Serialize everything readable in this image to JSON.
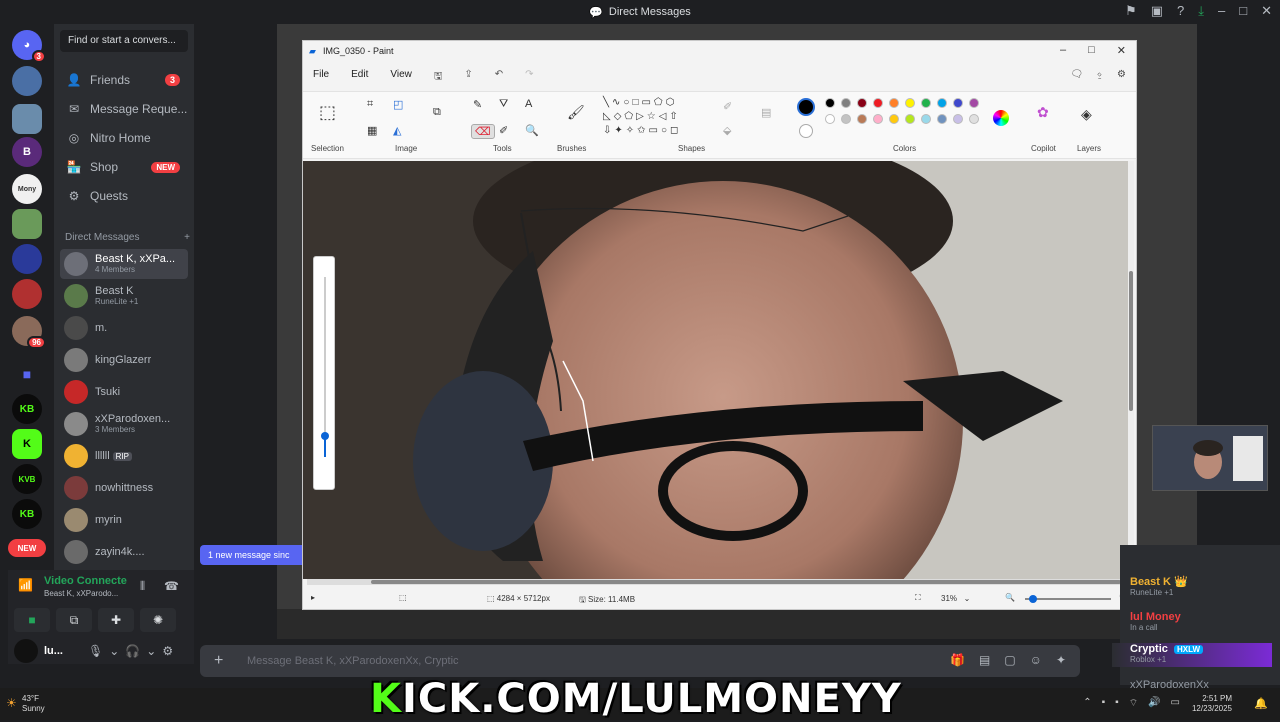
{
  "titlebar": {
    "title": "Direct Messages"
  },
  "sidebar": {
    "search_placeholder": "Find or start a convers...",
    "nav": [
      {
        "label": "Friends",
        "badge": "3"
      },
      {
        "label": "Message Reque..."
      },
      {
        "label": "Nitro Home"
      },
      {
        "label": "Shop",
        "badge": "NEW"
      },
      {
        "label": "Quests"
      }
    ],
    "dm_header": "Direct Messages",
    "dm_add": "+",
    "dms": [
      {
        "name": "Beast K, xXPa...",
        "sub": "4 Members",
        "color": "#6d6f78"
      },
      {
        "name": "Beast K",
        "sub": "RuneLite +1",
        "color": "#5a7a4a"
      },
      {
        "name": "m.",
        "sub": "",
        "color": "#4a4a4a"
      },
      {
        "name": "kingGlazerr",
        "sub": "",
        "color": "#7a7a7a"
      },
      {
        "name": "Tsuki",
        "sub": "",
        "color": "#c62828"
      },
      {
        "name": "xXParodoxen...",
        "sub": "3 Members",
        "color": "#8a8a8a"
      },
      {
        "name": "llllll",
        "tag": "RIP",
        "sub": "",
        "color": "#f0b232"
      },
      {
        "name": "nowhittness",
        "sub": "",
        "color": "#7b3b3b"
      },
      {
        "name": "myrin",
        "sub": "",
        "color": "#9a8a70"
      },
      {
        "name": "zayin4k....",
        "sub": "",
        "color": "#6a6a6a"
      }
    ],
    "new_messages_banner": "1 new message sinc"
  },
  "rail": {
    "badges": {
      "top": "3",
      "mid": "96"
    },
    "new_label": "NEW"
  },
  "voice": {
    "status": "Video Connecte",
    "channel": "Beast K, xXParodo..."
  },
  "user": {
    "name": "lu..."
  },
  "composer": {
    "plus": "+",
    "placeholder": "Message Beast K, xXParodoxenXx, Cryptic"
  },
  "paint": {
    "title": "IMG_0350 - Paint",
    "menu": [
      "File",
      "Edit",
      "View"
    ],
    "groups": [
      "Selection",
      "Image",
      "Tools",
      "Brushes",
      "Shapes",
      "Colors",
      "Copilot",
      "Layers"
    ],
    "status": {
      "dimensions": "4284 × 5712px",
      "size": "Size: 11.4MB",
      "zoom": "31%"
    },
    "colors_row1": [
      "#000000",
      "#7f7f7f",
      "#880015",
      "#ed1c24",
      "#ff7f27",
      "#fff200",
      "#22b14c",
      "#00a2e8",
      "#3f48cc",
      "#a349a4"
    ],
    "colors_row2": [
      "#ffffff",
      "#c3c3c3",
      "#b97a57",
      "#ffaec9",
      "#ffc90e",
      "#b5e61d",
      "#99d9ea",
      "#7092be",
      "#c8bfe7",
      "#e0e0e0"
    ]
  },
  "members": [
    {
      "name": "Beast K",
      "sub": "RuneLite +1",
      "color": "#f0b232"
    },
    {
      "name": "lul Money",
      "sub": "In a call",
      "color": "#f23f42"
    },
    {
      "name": "Cryptic",
      "tag": "HXLW",
      "sub": "Roblox +1",
      "color": "#ffffff"
    },
    {
      "name": "xXParodoxenXx",
      "sub": "",
      "color": "#949ba4"
    }
  ],
  "taskbar": {
    "temp": "43°F",
    "weather": "Sunny",
    "time": "2:51 PM",
    "date": "12/23/2025"
  },
  "overlay": {
    "kick_prefix": "K",
    "kick_rest": "ICK.COM/LULMONEYY"
  }
}
